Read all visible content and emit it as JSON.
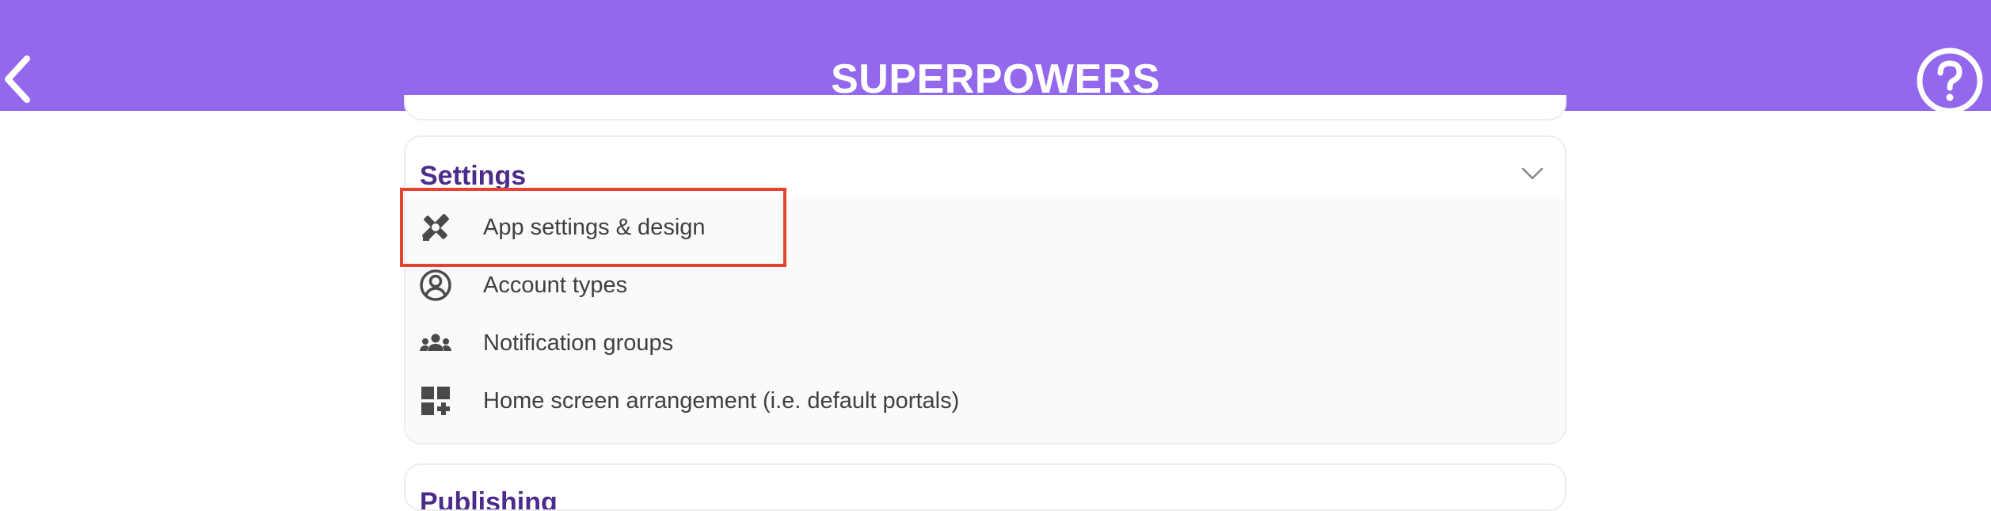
{
  "header": {
    "title": "SUPERPOWERS",
    "background": "#9368ED",
    "back_icon": "chevron-left-icon",
    "help_icon": "question-circle-icon"
  },
  "settings_section": {
    "title": "Settings",
    "title_color": "#4B2C8A",
    "expand_icon": "chevron-down-icon",
    "items": [
      {
        "label": "App settings & design",
        "icon": "tools-icon"
      },
      {
        "label": "Account types",
        "icon": "user-circle-icon"
      },
      {
        "label": "Notification groups",
        "icon": "group-icon"
      },
      {
        "label": "Home screen arrangement (i.e. default portals)",
        "icon": "grid-add-icon"
      }
    ]
  },
  "next_section": {
    "title": "Publishing"
  },
  "highlight": {
    "target": "App settings & design",
    "color": "#E4432F"
  }
}
